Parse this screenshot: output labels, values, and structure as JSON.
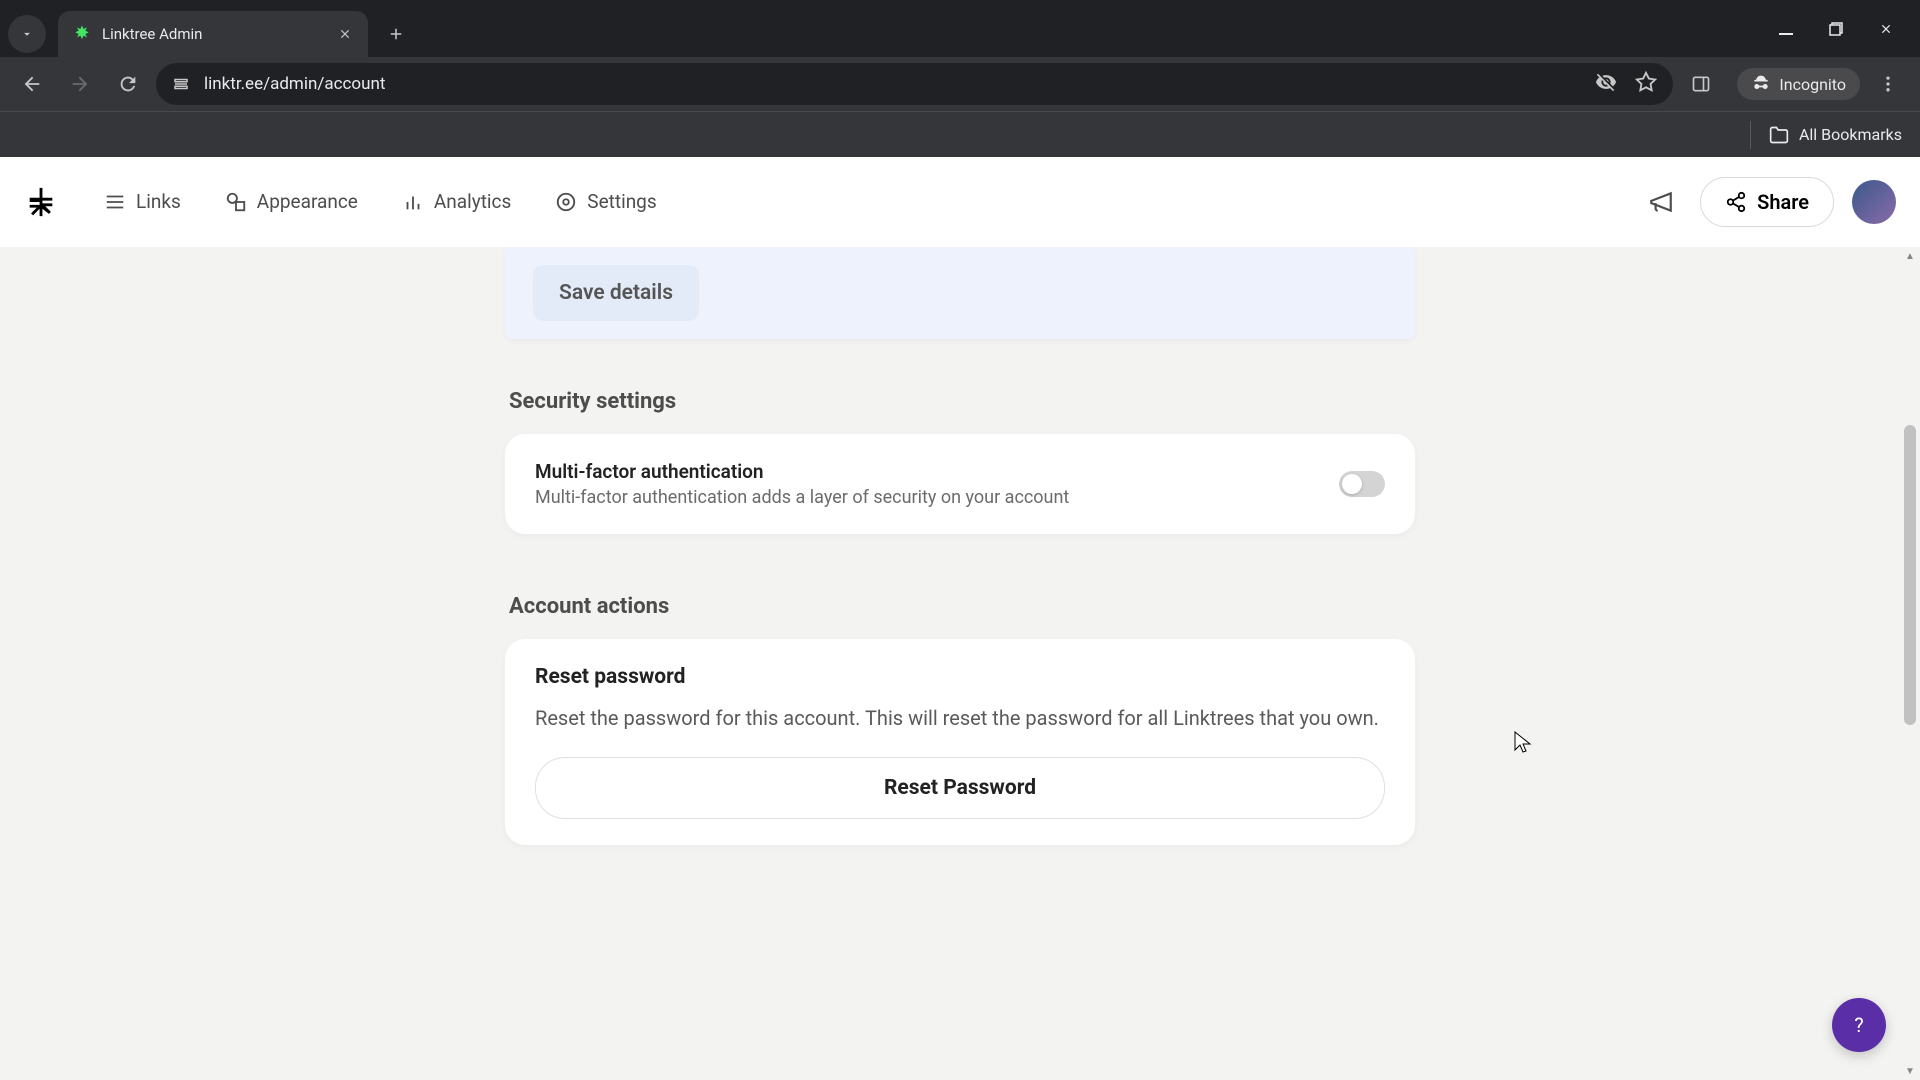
{
  "browser": {
    "tab_title": "Linktree Admin",
    "url": "linktr.ee/admin/account",
    "incognito_label": "Incognito",
    "all_bookmarks": "All Bookmarks"
  },
  "nav": {
    "links": "Links",
    "appearance": "Appearance",
    "analytics": "Analytics",
    "settings": "Settings",
    "share": "Share"
  },
  "main": {
    "save_details": "Save details",
    "security": {
      "heading": "Security settings",
      "mfa_title": "Multi-factor authentication",
      "mfa_desc": "Multi-factor authentication adds a layer of security on your account"
    },
    "account_actions": {
      "heading": "Account actions",
      "reset_title": "Reset password",
      "reset_desc": "Reset the password for this account. This will reset the password for all Linktrees that you own.",
      "reset_button": "Reset Password"
    }
  },
  "help_label": "?"
}
